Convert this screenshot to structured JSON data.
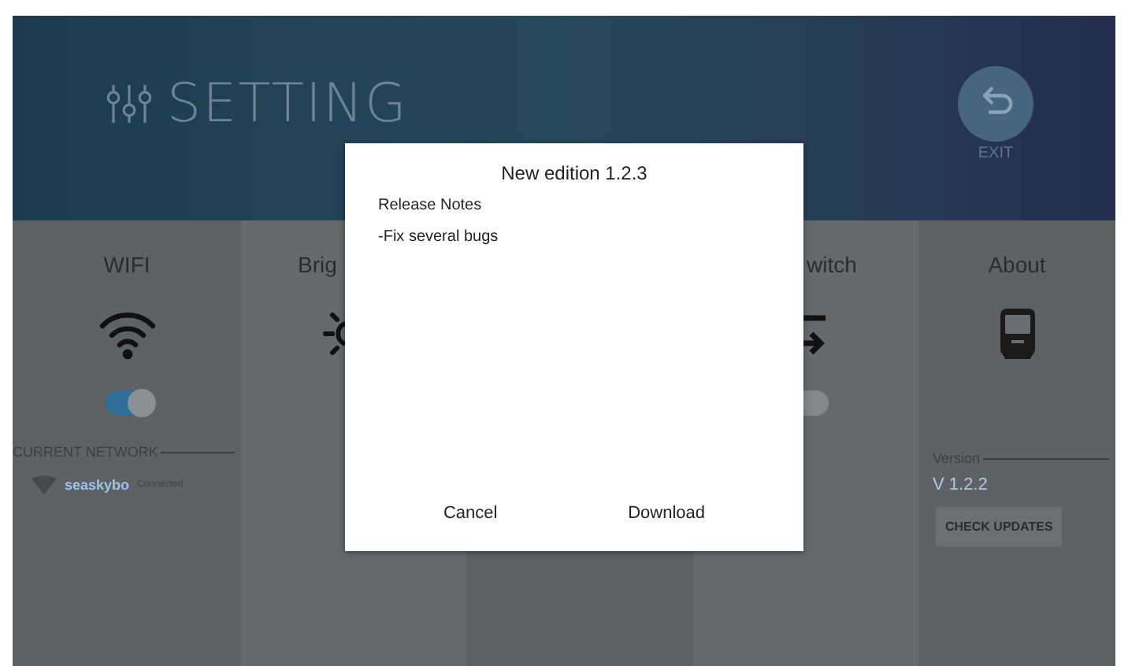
{
  "header": {
    "title": "SETTING",
    "exit_label": "EXIT"
  },
  "columns": [
    {
      "kind": "wifi",
      "title": "WIFI",
      "toggle_on": true,
      "section_label": "CURRENT NETWORK",
      "network": {
        "name": "seaskybo",
        "status": "Connected"
      }
    },
    {
      "kind": "brightness",
      "title": "Brig"
    },
    {
      "kind": "blank"
    },
    {
      "kind": "switch",
      "title": "witch",
      "toggle_on": false
    },
    {
      "kind": "about",
      "title": "About",
      "section_label": "Version",
      "version": "V 1.2.2",
      "button": "CHECK UPDATES"
    }
  ],
  "dialog": {
    "title": "New edition 1.2.3",
    "heading": "Release Notes",
    "notes": "-Fix several bugs",
    "buttons": [
      "Cancel",
      "Download"
    ]
  }
}
